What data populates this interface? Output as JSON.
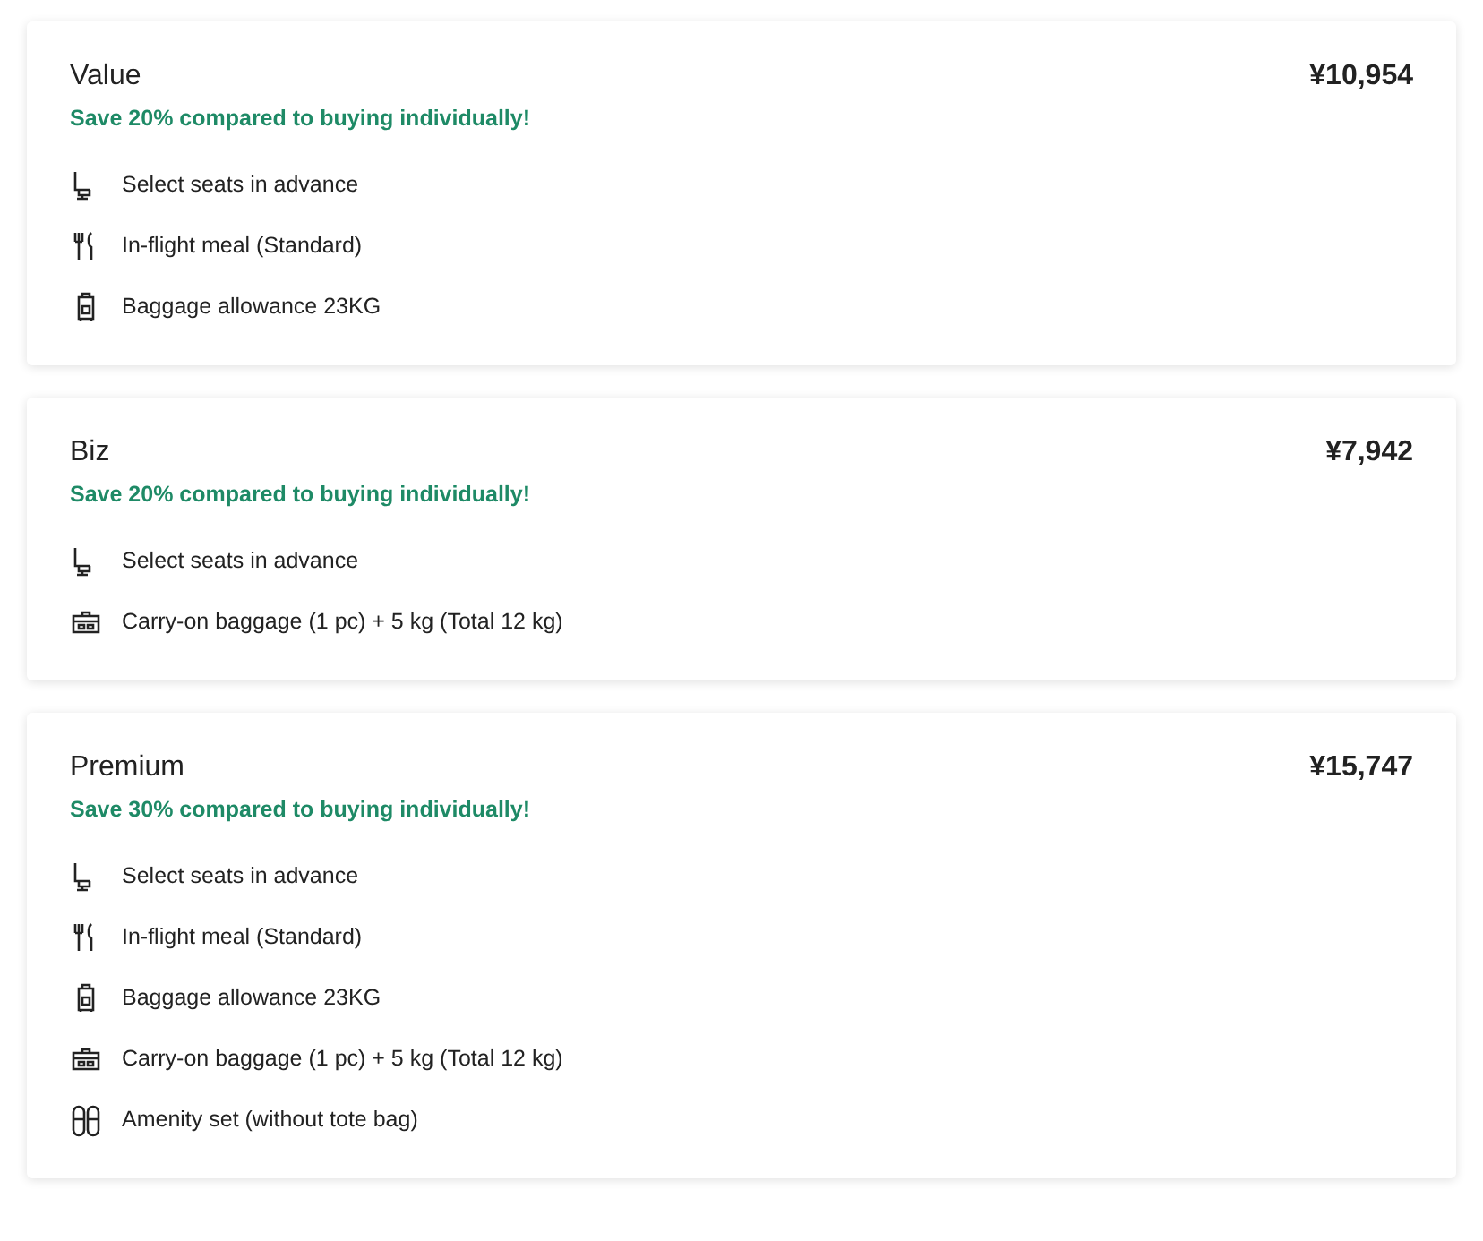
{
  "plans": [
    {
      "name": "Value",
      "price": "¥10,954",
      "saving": "Save 20% compared to buying individually!",
      "features": [
        {
          "kind": "seat",
          "text": "Select seats in advance"
        },
        {
          "kind": "meal",
          "text": "In-flight meal (Standard)"
        },
        {
          "kind": "baggage",
          "text": "Baggage allowance 23KG"
        }
      ]
    },
    {
      "name": "Biz",
      "price": "¥7,942",
      "saving": "Save 20% compared to buying individually!",
      "features": [
        {
          "kind": "seat",
          "text": "Select seats in advance"
        },
        {
          "kind": "carryon",
          "text": "Carry-on baggage (1 pc) + 5 kg (Total 12 kg)"
        }
      ]
    },
    {
      "name": "Premium",
      "price": "¥15,747",
      "saving": "Save 30% compared to buying individually!",
      "features": [
        {
          "kind": "seat",
          "text": "Select seats in advance"
        },
        {
          "kind": "meal",
          "text": "In-flight meal (Standard)"
        },
        {
          "kind": "baggage",
          "text": "Baggage allowance 23KG"
        },
        {
          "kind": "carryon",
          "text": "Carry-on baggage (1 pc) + 5 kg (Total 12 kg)"
        },
        {
          "kind": "amenity",
          "text": "Amenity set (without tote bag)"
        }
      ]
    }
  ]
}
